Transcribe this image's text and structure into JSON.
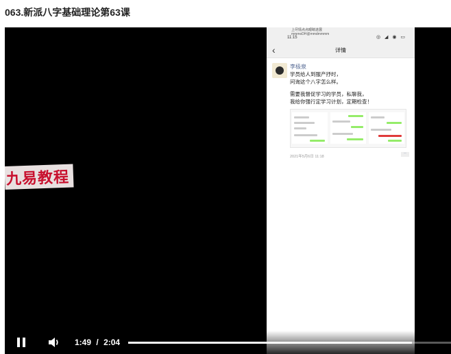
{
  "page": {
    "title": "063.新派八字基础理论第63课"
  },
  "video": {
    "watermark": "九易教程",
    "phone": {
      "status_time": "11:15",
      "status_notify_line1": "上尽情点点眼睛进展",
      "status_notify_line2": "mmmoDH@mmdmmmm",
      "status_icons": "◎ ◢ ◉ ▭",
      "nav_title": "详情",
      "post": {
        "author": "李极泉",
        "lines": [
          "学员给人到服产抒时，",
          "问询这个八字怎么样。",
          "需要我督促学习的学员，私聊我，",
          "我给你强行定学习计划，定期检查！"
        ],
        "timestamp": "2021年5月6日 11:18"
      }
    },
    "controls": {
      "current_time": "1:49",
      "separator": "/",
      "duration": "2:04",
      "progress": 0.879
    }
  }
}
